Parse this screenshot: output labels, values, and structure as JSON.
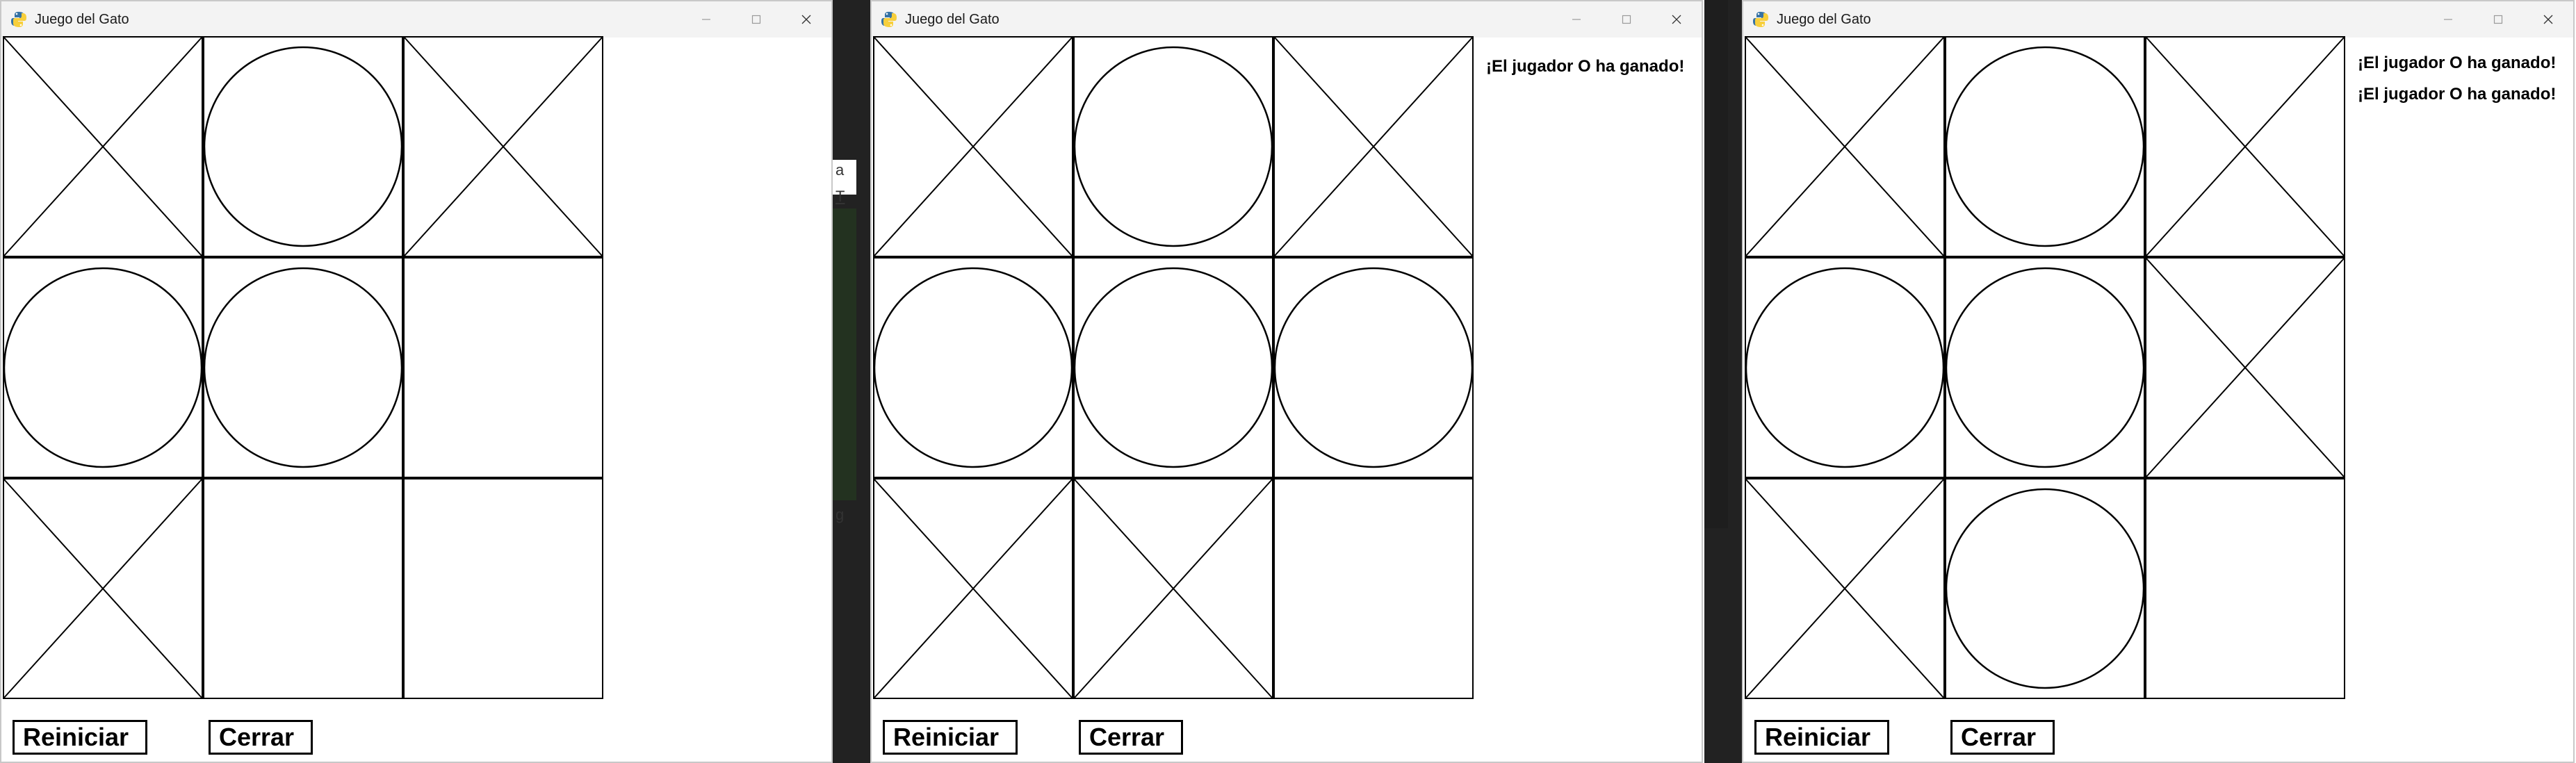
{
  "windows": [
    {
      "title": "Juego del Gato",
      "board": [
        "X",
        "O",
        "X",
        "O",
        "O",
        "",
        "X",
        "",
        ""
      ],
      "messages": [],
      "buttons": {
        "restart": "Reiniciar",
        "close": "Cerrar"
      }
    },
    {
      "title": "Juego del Gato",
      "board": [
        "X",
        "O",
        "X",
        "O",
        "O",
        "O",
        "X",
        "X",
        ""
      ],
      "messages": [
        "¡El jugador O ha ganado!"
      ],
      "buttons": {
        "restart": "Reiniciar",
        "close": "Cerrar"
      }
    },
    {
      "title": "Juego del Gato",
      "board": [
        "X",
        "O",
        "X",
        "O",
        "O",
        "X",
        "X",
        "O",
        ""
      ],
      "messages": [
        "¡El jugador O ha ganado!",
        "¡El jugador O ha ganado!"
      ],
      "buttons": {
        "restart": "Reiniciar",
        "close": "Cerrar"
      }
    }
  ],
  "background_fragments": [
    "a",
    "T",
    "g"
  ],
  "icons": {
    "app": "python-snake-icon",
    "minimize": "minimize-icon",
    "maximize": "maximize-icon",
    "close": "close-icon"
  },
  "colors": {
    "titlebar": "#f3f3f3",
    "ink": "#000000",
    "window_bg": "#ffffff"
  }
}
